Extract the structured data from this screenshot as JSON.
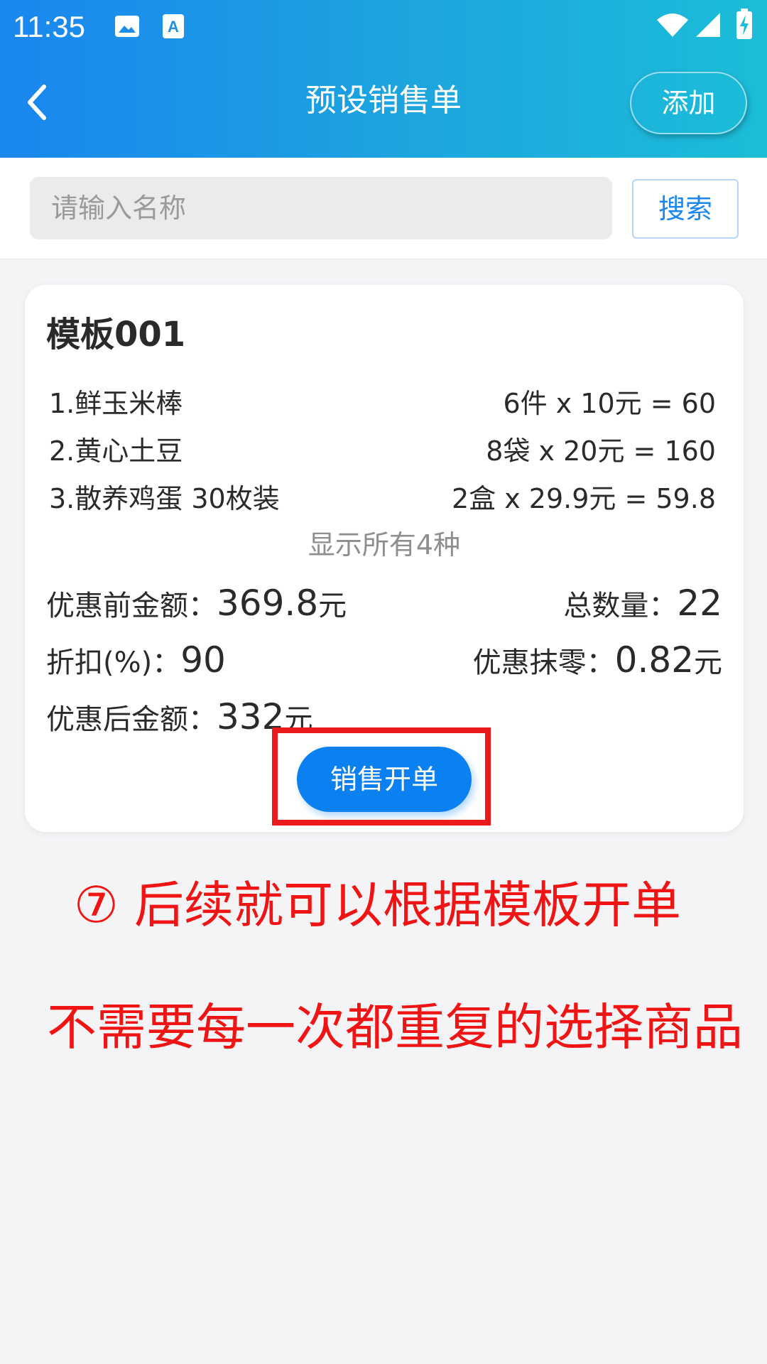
{
  "status_bar": {
    "time": "11:35",
    "icons": [
      "image-icon",
      "text-a-icon",
      "wifi-icon",
      "signal-icon",
      "battery-charging-icon"
    ]
  },
  "header": {
    "title": "预设销售单",
    "add_label": "添加",
    "back_icon": "chevron-left-icon"
  },
  "search": {
    "placeholder": "请输入名称",
    "button_label": "搜索"
  },
  "template_card": {
    "title": "模板001",
    "items": [
      {
        "name": "1.鲜玉米棒",
        "calc": "6件 x 10元 = 60"
      },
      {
        "name": "2.黄心土豆",
        "calc": "8袋 x 20元 = 160"
      },
      {
        "name": "3.散养鸡蛋 30枚装",
        "calc": "2盒 x 29.9元 = 59.8"
      }
    ],
    "show_all": "显示所有4种",
    "pre_discount_label": "优惠前金额：",
    "pre_discount_value": "369.8",
    "pre_discount_unit": "元",
    "total_qty_label": "总数量：",
    "total_qty_value": "22",
    "discount_label": "折扣(%)：",
    "discount_value": "90",
    "round_off_label": "优惠抹零：",
    "round_off_value": "0.82",
    "round_off_unit": "元",
    "post_discount_label": "优惠后金额：",
    "post_discount_value": "332",
    "post_discount_unit": "元",
    "sale_button_label": "销售开单"
  },
  "annotation": {
    "line1": "⑦ 后续就可以根据模板开单",
    "line2": "不需要每一次都重复的选择商品",
    "highlight_color": "#ec1a1a"
  },
  "colors": {
    "primary": "#0b80f0",
    "header_start": "#1a86ef",
    "header_end": "#1bbdd8",
    "annotation": "#f01414"
  }
}
